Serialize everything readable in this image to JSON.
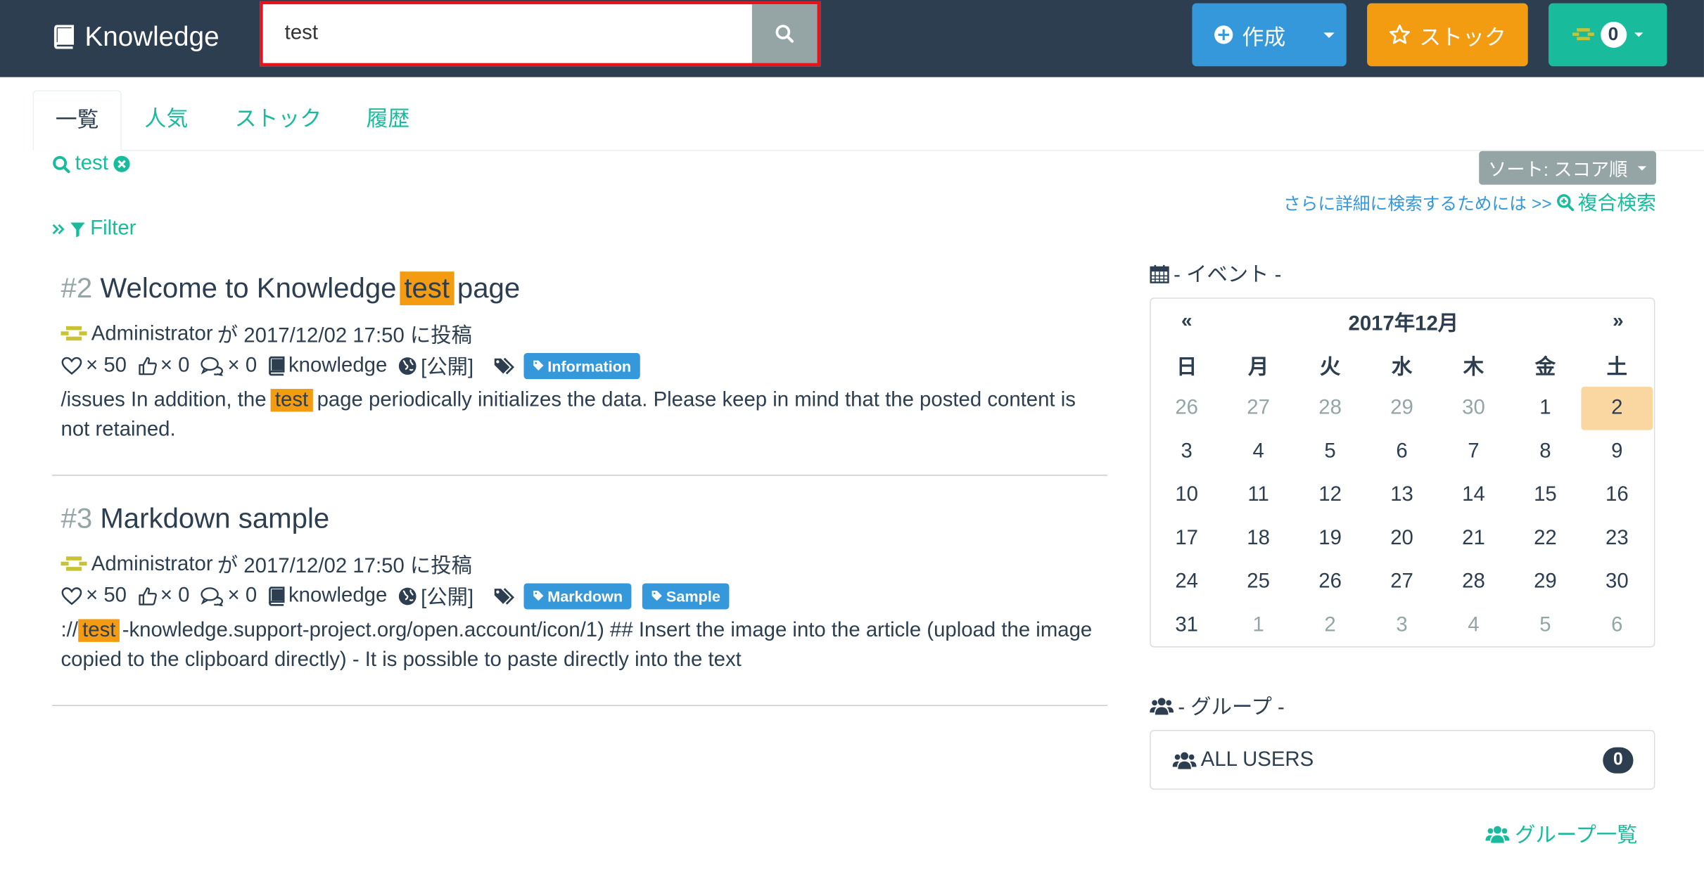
{
  "navbar": {
    "brand": "Knowledge",
    "search_value": "test",
    "create_label": "作成",
    "stock_label": "ストック",
    "notify_count": "0"
  },
  "tabs": [
    {
      "label": "一覧"
    },
    {
      "label": "人気"
    },
    {
      "label": "ストック"
    },
    {
      "label": "履歴"
    }
  ],
  "query": {
    "term": "test"
  },
  "sort_label": "ソート: スコア順",
  "advanced": {
    "prefix": "さらに詳細に検索するためには >>",
    "link": "複合検索"
  },
  "filter_label": "Filter",
  "articles": [
    {
      "num": "#2",
      "title_before": "Welcome to Knowledge",
      "title_hl": "test",
      "title_after": "page",
      "author": "Administrator",
      "posted": "が 2017/12/02 17:50 に投稿",
      "likes": "× 50",
      "thumbs": "× 0",
      "comments": "× 0",
      "space": "knowledge",
      "visibility": "[公開]",
      "tags": [
        "Information"
      ],
      "body_before": "/issues In addition, the",
      "body_hl": "test",
      "body_after": "page periodically initializes the data. Please keep in mind that the posted content is not retained."
    },
    {
      "num": "#3",
      "title_before": "Markdown sample",
      "title_hl": "",
      "title_after": "",
      "author": "Administrator",
      "posted": "が 2017/12/02 17:50 に投稿",
      "likes": "× 50",
      "thumbs": "× 0",
      "comments": "× 0",
      "space": "knowledge",
      "visibility": "[公開]",
      "tags": [
        "Markdown",
        "Sample"
      ],
      "body_before": "://",
      "body_hl": "test",
      "body_after": "-knowledge.support-project.org/open.account/icon/1) ## Insert the image into the article (upload the image copied to the clipboard directly) - It is possible to paste directly into the text"
    }
  ],
  "events": {
    "heading": "- イベント -",
    "month": "2017年12月",
    "prev": "«",
    "next": "»",
    "weekdays": [
      "日",
      "月",
      "火",
      "水",
      "木",
      "金",
      "土"
    ],
    "weeks": [
      [
        "26",
        "27",
        "28",
        "29",
        "30",
        "1",
        "2"
      ],
      [
        "3",
        "4",
        "5",
        "6",
        "7",
        "8",
        "9"
      ],
      [
        "10",
        "11",
        "12",
        "13",
        "14",
        "15",
        "16"
      ],
      [
        "17",
        "18",
        "19",
        "20",
        "21",
        "22",
        "23"
      ],
      [
        "24",
        "25",
        "26",
        "27",
        "28",
        "29",
        "30"
      ],
      [
        "31",
        "1",
        "2",
        "3",
        "4",
        "5",
        "6"
      ]
    ],
    "today": "2"
  },
  "groups": {
    "heading": "- グループ -",
    "items": [
      {
        "name": "ALL USERS",
        "count": "0"
      }
    ],
    "list_link": "グループ一覧"
  }
}
